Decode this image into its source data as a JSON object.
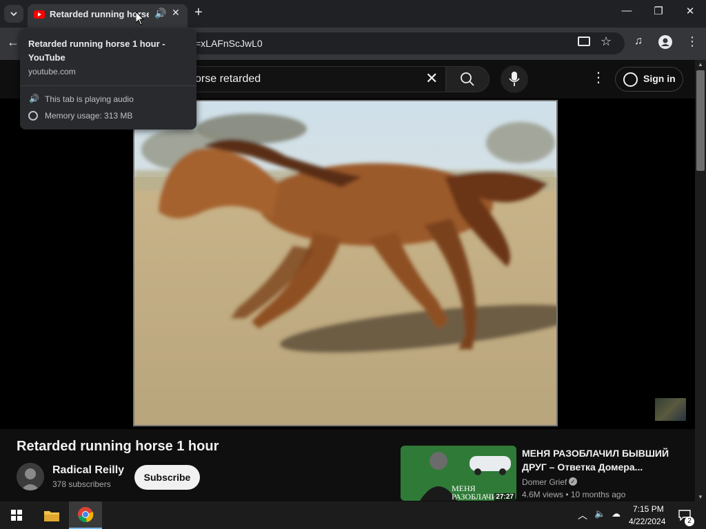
{
  "browser": {
    "tab": {
      "title": "Retarded running horse 1 hour - YouTube",
      "audio_icon": "speaker-icon",
      "close_label": "✕"
    },
    "new_tab_label": "+",
    "window_controls": {
      "minimize": "—",
      "maximize": "❐",
      "close": "✕"
    },
    "address_bar": {
      "url": "v=xLAFnScJwL0"
    },
    "tooltip": {
      "title": "Retarded running horse 1 hour - YouTube",
      "domain": "youtube.com",
      "audio_status": "This tab is playing audio",
      "memory_usage": "Memory usage: 313 MB"
    }
  },
  "youtube": {
    "search": {
      "query": "orse retarded"
    },
    "sign_in_label": "Sign in",
    "video": {
      "title": "Retarded running horse 1 hour",
      "channel_name": "Radical Reilly",
      "subscribers": "378 subscribers",
      "subscribe_label": "Subscribe"
    },
    "recommendation": {
      "title": "МЕНЯ РАЗОБЛАЧИЛ БЫВШИЙ ДРУГ – Ответка Домера...",
      "channel": "Domer Grief",
      "meta": "4.6M views • 10 months ago",
      "thumb_text": "МЕНЯ РАЗОБЛАЧИЛ",
      "duration": "27:27"
    }
  },
  "taskbar": {
    "time": "7:15 PM",
    "date": "4/22/2024",
    "notification_count": "2"
  },
  "colors": {
    "youtube_bg": "#0f0f0f",
    "chrome_frame": "#202124",
    "chrome_toolbar": "#35363a",
    "youtube_red": "#ff0000"
  }
}
